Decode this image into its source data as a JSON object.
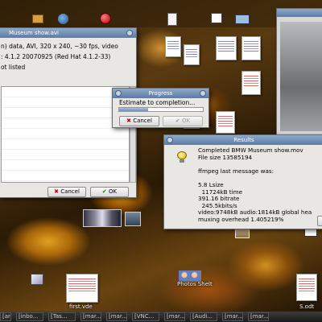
{
  "main_window": {
    "title": "Museum show.avi",
    "line1": "n) data, AVI, 320 x 240, ~30 fps, video",
    "line2": ": 4.1.2 20070925 (Red Hat 4.1.2-33)",
    "line3": "ot listed",
    "cancel_label": "Cancel",
    "ok_label": "OK"
  },
  "progress_dialog": {
    "title": "Progress",
    "message": "Estimate to completion...",
    "progress_fraction": 0.35,
    "cancel_label": "Cancel",
    "ok_label": "OK"
  },
  "results_dialog": {
    "title": "Results",
    "lines": [
      "Completed BMW Museum show.mov",
      "File size 13585194",
      "",
      "ffmpeg last message was:",
      "",
      "5.8 Lsize",
      "  11724kB time",
      "391.16 bitrate",
      "  245.5kbits/s",
      "video:9748kB audio:1814kB global hea",
      "muxing overhead 1.405219%"
    ]
  },
  "desktop_labels": {
    "first": "first.vde",
    "photos": "Photos Shelt",
    "s_odt": "S.odt"
  },
  "taskbar": {
    "items": [
      "[ar",
      "[inbo...",
      "[Tas...",
      "[mar...",
      "[mar...",
      "[VNC...",
      "[mar...",
      "[Audi...",
      "[mar...",
      "[mar..."
    ]
  },
  "colors": {
    "titlebar": "#5d7ba3",
    "dialog_bg": "#e9e7e3",
    "progress_fill": "#6f8fbf"
  }
}
